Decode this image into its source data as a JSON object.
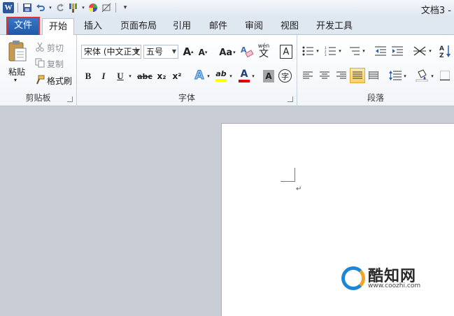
{
  "title_bar": {
    "app_logo": "W",
    "document_title": "文档3 -",
    "qat_icons": [
      "save-icon",
      "undo-icon",
      "redo-icon",
      "format-painter-icon",
      "color-icon",
      "edit-icon",
      "customize-icon"
    ]
  },
  "tabs": [
    {
      "label": "文件",
      "type": "file"
    },
    {
      "label": "开始",
      "type": "active"
    },
    {
      "label": "插入"
    },
    {
      "label": "页面布局"
    },
    {
      "label": "引用"
    },
    {
      "label": "邮件"
    },
    {
      "label": "审阅"
    },
    {
      "label": "视图"
    },
    {
      "label": "开发工具"
    }
  ],
  "clipboard": {
    "group_label": "剪贴板",
    "paste_label": "粘贴",
    "cut_label": "剪切",
    "copy_label": "复制",
    "format_painter_label": "格式刷"
  },
  "font": {
    "group_label": "字体",
    "font_name": "宋体 (中文正文",
    "font_size": "五号",
    "grow_label": "A",
    "shrink_label": "A",
    "change_case_label": "Aa",
    "pinyin_label": "wén",
    "phonetic_char": "文",
    "char_border_label": "A",
    "bold": "B",
    "italic": "I",
    "underline": "U",
    "strike": "abc",
    "subscript": "x₂",
    "superscript": "x²",
    "text_effect": "A",
    "highlight": "ab",
    "font_color": "A",
    "char_shading": "A",
    "enclosed_char": "字"
  },
  "paragraph": {
    "group_label": "段落"
  },
  "sort_label": "A↓Z",
  "colors": {
    "file_tab": "#2b6cc4",
    "highlight_box": "#e0322b",
    "accent": "#2b579a"
  },
  "document": {
    "paragraph_mark": "↵"
  },
  "watermark": {
    "title": "酷知网",
    "url": "www.coozhi.com"
  }
}
